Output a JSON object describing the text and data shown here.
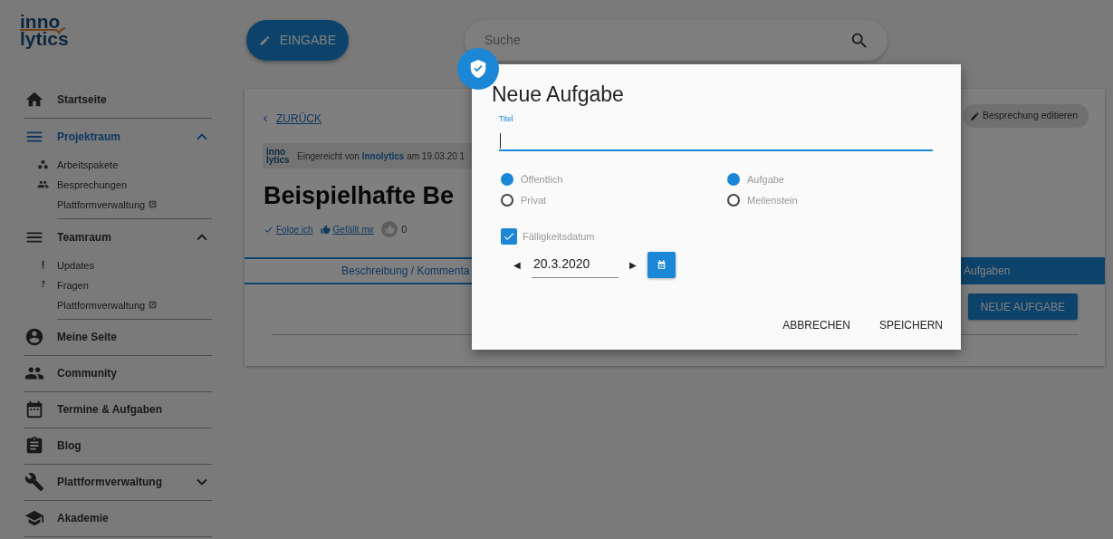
{
  "logo": {
    "line_1": "inno",
    "line_2": "lytics"
  },
  "sidebar": {
    "items": [
      {
        "label": "Startseite",
        "selected": false
      },
      {
        "label": "Projektraum",
        "selected": true,
        "expanded": true,
        "children": [
          {
            "label": "Arbeitspakete",
            "external": false
          },
          {
            "label": "Besprechungen",
            "external": false
          },
          {
            "label": "Plattformverwaltung",
            "external": true
          }
        ]
      },
      {
        "label": "Teamraum",
        "selected": false,
        "expanded": true,
        "children": [
          {
            "label": "Updates",
            "external": false
          },
          {
            "label": "Fragen",
            "external": false
          },
          {
            "label": "Plattformverwaltung",
            "external": true
          }
        ]
      },
      {
        "label": "Meine Seite",
        "selected": false
      },
      {
        "label": "Community",
        "selected": false
      },
      {
        "label": "Termine & Aufgaben",
        "selected": false
      },
      {
        "label": "Blog",
        "selected": false
      },
      {
        "label": "Plattformverwaltung",
        "selected": false,
        "expanded": false
      },
      {
        "label": "Akademie",
        "selected": false
      }
    ]
  },
  "toolbar": {
    "entry_button": "EINGABE",
    "search": {
      "placeholder": "Suche"
    }
  },
  "page": {
    "back_link": "ZURÜCK",
    "meta_logo": {
      "line_1": "inno",
      "line_2": "lytics"
    },
    "meta": "Eingereicht von **Innolytics** am 19.03.20 1",
    "title": "Beispielhafte Be",
    "edit_button": "Besprechung editieren",
    "actions": {
      "follow": "Folge ich",
      "like": "Gefällt mir",
      "like_count": "0"
    },
    "tabs": [
      {
        "label": "Beschreibung / Kommenta",
        "selected": false
      },
      {
        "label": "Aufgaben",
        "selected": true
      }
    ],
    "new_task_button": "NEUE AUFGABE"
  },
  "dialog": {
    "title": "Neue Aufgabe",
    "title_field": {
      "label": "Titel"
    },
    "visibility": [
      {
        "label": "Öffentlich",
        "selected": true
      },
      {
        "label": "Privat",
        "selected": false
      }
    ],
    "type": [
      {
        "label": "Aufgabe",
        "selected": true
      },
      {
        "label": "Meilenstein",
        "selected": false
      }
    ],
    "due_date": {
      "label": "Fälligkeitsdatum",
      "checked": true,
      "prev": "◀",
      "value": "20.3.2020",
      "next": "▶"
    },
    "buttons": [
      "ABBRECHEN",
      "SPEICHERN"
    ]
  }
}
